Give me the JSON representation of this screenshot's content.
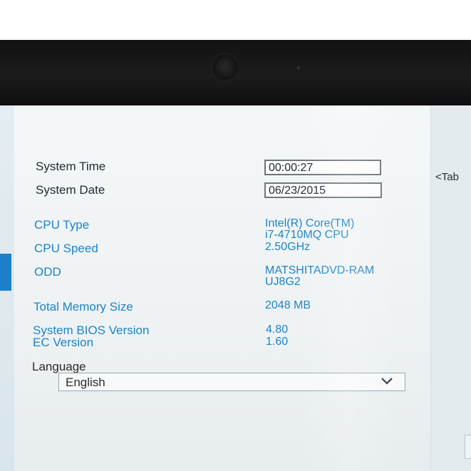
{
  "fields": {
    "system_time": {
      "label": "System Time",
      "value": "00:00:27"
    },
    "system_date": {
      "label": "System Date",
      "value": "06/23/2015"
    }
  },
  "info": {
    "cpu_type": {
      "label": "CPU Type",
      "value_line1": "Intel(R) Core(TM)",
      "value_line2": "i7-4710MQ CPU"
    },
    "cpu_speed": {
      "label": "CPU Speed",
      "value": "2.50GHz"
    },
    "odd": {
      "label": "ODD",
      "value_line1": "MATSHITADVD-RAM",
      "value_line2": "UJ8G2"
    },
    "total_memory": {
      "label": "Total Memory Size",
      "value": "2048 MB"
    },
    "bios_version": {
      "label": "System BIOS Version",
      "value": "4.80"
    },
    "ec_version": {
      "label": "EC Version",
      "value": "1.60"
    }
  },
  "language": {
    "label": "Language",
    "selected": "English",
    "icon": "chevron-down-icon"
  },
  "help_panel": {
    "tab_hint": "<Tab"
  },
  "colors": {
    "label_dark": "#1f2b33",
    "label_blue": "#1b84c8",
    "accent": "#1d7fc8"
  }
}
